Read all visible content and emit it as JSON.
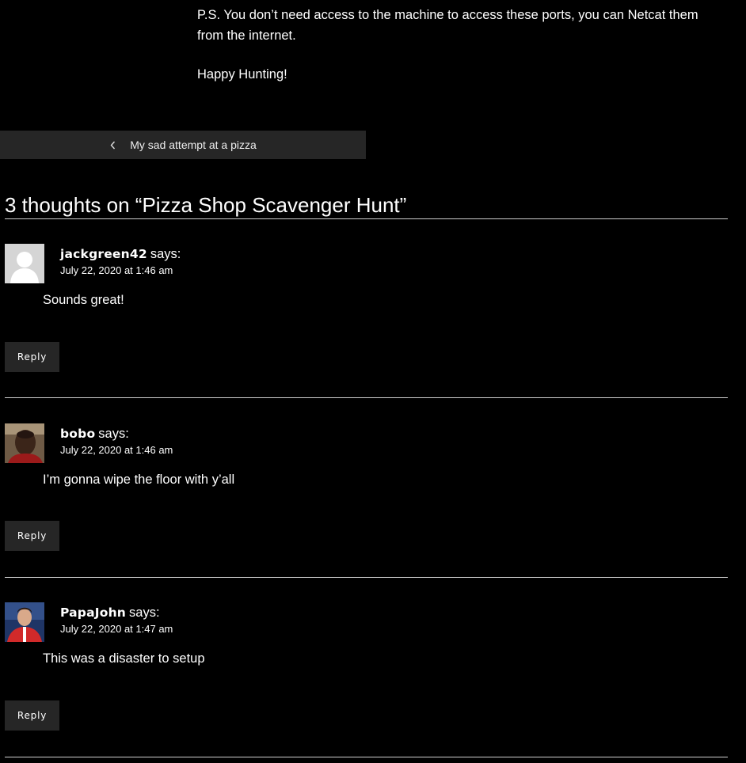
{
  "post": {
    "paragraph1": "P.S. You don’t need access to the machine to access these ports, you can Netcat them from the internet.",
    "paragraph2": "Happy Hunting!"
  },
  "post_nav": {
    "previous_icon": "chevron-left-icon",
    "previous_label": "My sad attempt at a pizza"
  },
  "comments_title": "3 thoughts on “Pizza Shop Scavenger Hunt”",
  "comments": [
    {
      "author": "jackgreen42",
      "says": "says:",
      "date": "July 22, 2020 at 1:46 am",
      "text": "Sounds great!",
      "reply_label": "Reply",
      "avatar": "default-avatar-icon"
    },
    {
      "author": "bobo",
      "says": "says:",
      "date": "July 22, 2020 at 1:46 am",
      "text": "I’m gonna wipe the floor with y’all",
      "reply_label": "Reply",
      "avatar": "user-photo-avatar"
    },
    {
      "author": "PapaJohn",
      "says": "says:",
      "date": "July 22, 2020 at 1:47 am",
      "text": "This was a disaster to setup",
      "reply_label": "Reply",
      "avatar": "user-photo-avatar"
    }
  ]
}
